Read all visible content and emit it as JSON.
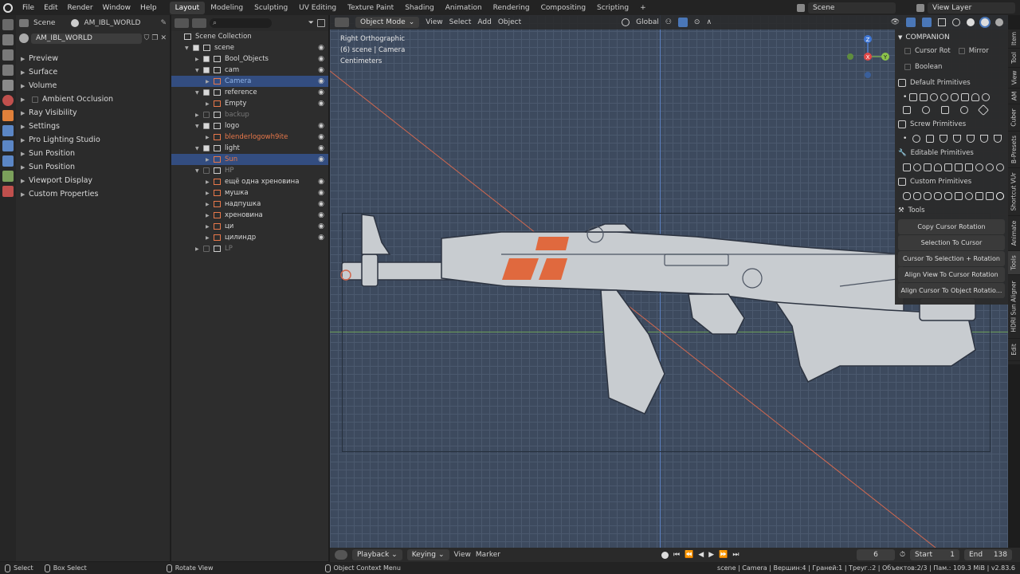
{
  "topbar": {
    "menus": [
      "File",
      "Edit",
      "Render",
      "Window",
      "Help"
    ],
    "workspaces": [
      "Layout",
      "Modeling",
      "Sculpting",
      "UV Editing",
      "Texture Paint",
      "Shading",
      "Animation",
      "Rendering",
      "Compositing",
      "Scripting"
    ],
    "active_workspace": "Layout",
    "add_tab": "+",
    "scene": "Scene",
    "view_layer": "View Layer"
  },
  "props": {
    "scene_label": "Scene",
    "world_tab": "AM_IBL_WORLD",
    "world_field": "AM_IBL_WORLD",
    "sections": [
      "Preview",
      "Surface",
      "Volume",
      "Ambient Occlusion",
      "Ray Visibility",
      "Settings",
      "Pro Lighting Studio",
      "Sun Position",
      "Sun Position",
      "Viewport Display",
      "Custom Properties"
    ]
  },
  "outliner": {
    "root": "Scene Collection",
    "rows": [
      {
        "label": "scene",
        "indent": 1,
        "sel": false,
        "dis": false,
        "color": "#d8d8d8"
      },
      {
        "label": "Bool_Objects",
        "indent": 2,
        "sel": false,
        "dis": false,
        "color": "#d8d8d8"
      },
      {
        "label": "cam",
        "indent": 2,
        "sel": false,
        "dis": false,
        "color": "#d8d8d8"
      },
      {
        "label": "Camera",
        "indent": 3,
        "sel": true,
        "dis": false,
        "color": "#8fb4e8"
      },
      {
        "label": "reference",
        "indent": 2,
        "sel": false,
        "dis": false,
        "color": "#d8d8d8"
      },
      {
        "label": "Empty",
        "indent": 3,
        "sel": false,
        "dis": false,
        "color": "#d8d8d8"
      },
      {
        "label": "backup",
        "indent": 2,
        "sel": false,
        "dis": true,
        "color": "#777777"
      },
      {
        "label": "logo",
        "indent": 2,
        "sel": false,
        "dis": false,
        "color": "#d8d8d8"
      },
      {
        "label": "blenderlogowh9ite",
        "indent": 3,
        "sel": false,
        "dis": false,
        "color": "#e8784a"
      },
      {
        "label": "light",
        "indent": 2,
        "sel": false,
        "dis": false,
        "color": "#d8d8d8"
      },
      {
        "label": "Sun",
        "indent": 3,
        "sel": true,
        "dis": false,
        "color": "#e8784a"
      },
      {
        "label": "HP",
        "indent": 2,
        "sel": false,
        "dis": true,
        "color": "#888888"
      },
      {
        "label": "ещё одна хреновина",
        "indent": 3,
        "sel": false,
        "dis": false,
        "color": "#d8d8d8"
      },
      {
        "label": "мушка",
        "indent": 3,
        "sel": false,
        "dis": false,
        "color": "#d8d8d8"
      },
      {
        "label": "надпушка",
        "indent": 3,
        "sel": false,
        "dis": false,
        "color": "#d8d8d8"
      },
      {
        "label": "хреновина",
        "indent": 3,
        "sel": false,
        "dis": false,
        "color": "#d8d8d8"
      },
      {
        "label": "ци",
        "indent": 3,
        "sel": false,
        "dis": false,
        "color": "#d8d8d8"
      },
      {
        "label": "цилиндр",
        "indent": 3,
        "sel": false,
        "dis": false,
        "color": "#d8d8d8"
      },
      {
        "label": "LP",
        "indent": 2,
        "sel": false,
        "dis": true,
        "color": "#777777"
      }
    ]
  },
  "viewport": {
    "mode": "Object Mode",
    "menus": [
      "View",
      "Select",
      "Add",
      "Object"
    ],
    "orientation": "Global",
    "info_lines": [
      "Right Orthographic",
      "(6) scene | Camera",
      "Centimeters"
    ],
    "gizmo": {
      "z": "Z",
      "x": "X",
      "y": "Y"
    }
  },
  "companion": {
    "title": "COMPANION",
    "cursor_rot": "Cursor Rot",
    "mirror": "Mirror",
    "boolean": "Boolean",
    "default_primitives": "Default Primitives",
    "screw_primitives": "Screw Primitives",
    "editable_primitives": "Editable Primitives",
    "custom_primitives": "Custom Primitives",
    "tools": "Tools",
    "buttons": [
      "Copy Cursor Rotation",
      "Selection To Cursor",
      "Cursor To Selection + Rotation",
      "Align View To Cursor Rotation",
      "Align Cursor To Object Rotatio..."
    ]
  },
  "vtabs": [
    "Item",
    "Tool",
    "View",
    "AM",
    "Cuber",
    "B-Presets",
    "Shortcut VUr",
    "Animate",
    "Tools",
    "HDRI Sun Aligner",
    "Edit"
  ],
  "timeline": {
    "playback": "Playback",
    "keying": "Keying",
    "view": "View",
    "marker": "Marker",
    "current_frame": "6",
    "start_label": "Start",
    "start": "1",
    "end_label": "End",
    "end": "138"
  },
  "status": {
    "select": "Select",
    "box_select": "Box Select",
    "rotate_view": "Rotate View",
    "context_menu": "Object Context Menu",
    "stats": "scene | Camera | Вершин:4 | Граней:1 | Треуг.:2 | Объектов:2/3 | Пам.: 109.3 MiB | v2.83.6"
  }
}
